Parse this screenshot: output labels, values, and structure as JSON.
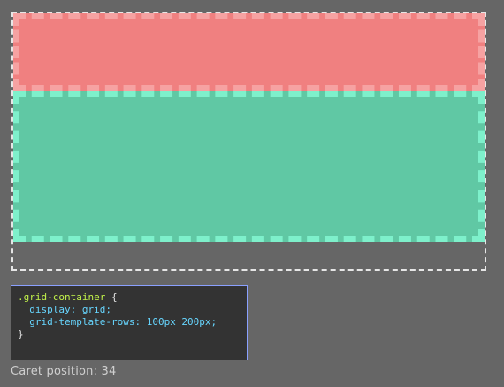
{
  "grid": {
    "items": [
      {
        "label": "",
        "color": "#f08080",
        "border_color": "#f6a2a2"
      },
      {
        "label": "",
        "color": "#60c8a4",
        "border_color": "#7ef0cb"
      }
    ],
    "container_border_color": "#e6e6e6",
    "background": "#666666"
  },
  "editor": {
    "line1_selector": ".grid-container",
    "line1_brace": " {",
    "line2_prop": "display: grid;",
    "line3_prop": "grid-template-rows: 100px 200px;",
    "line4_brace": "}",
    "border_color": "#8aa0ff"
  },
  "status": {
    "caret_label": "Caret position: 34"
  }
}
